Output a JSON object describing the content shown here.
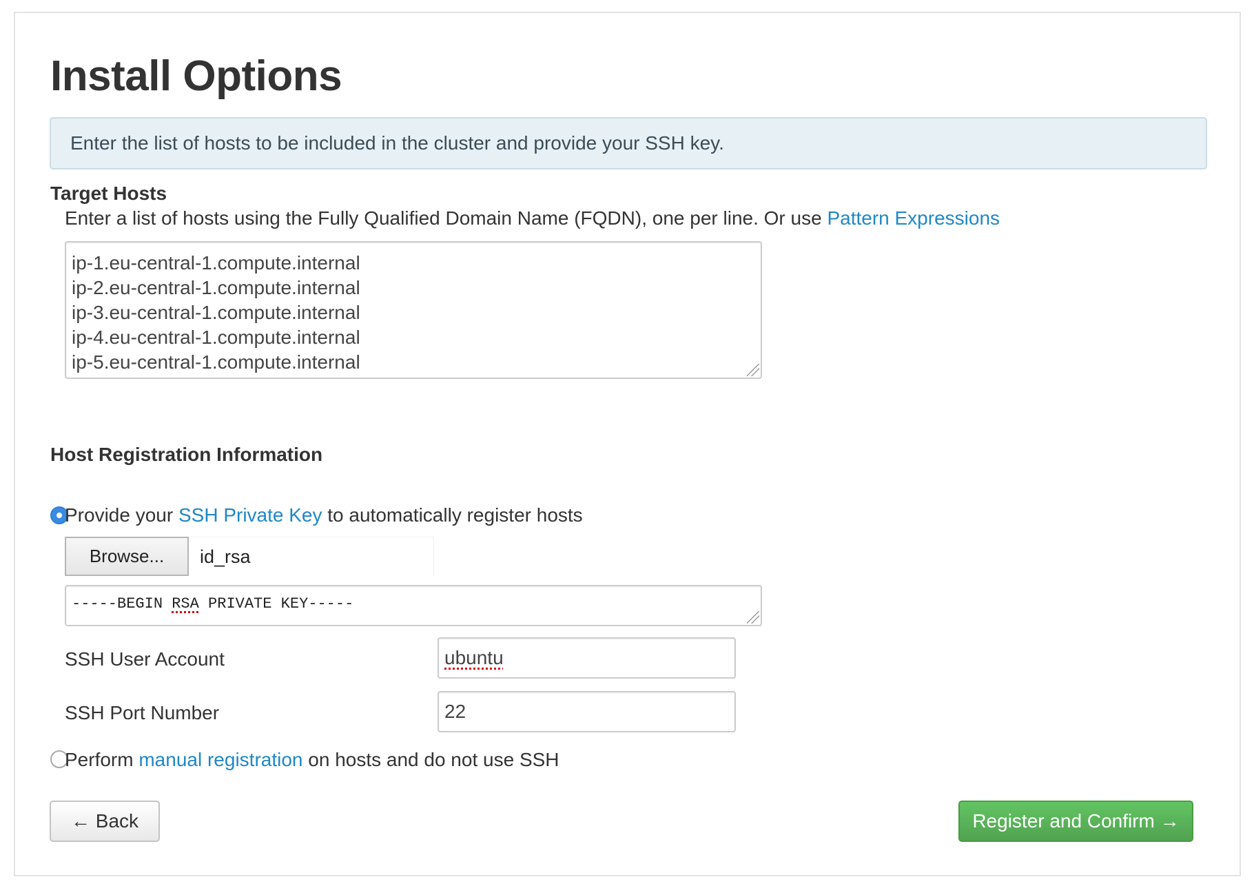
{
  "page": {
    "title": "Install Options",
    "info": "Enter the list of hosts to be included in the cluster and provide your SSH key."
  },
  "target_hosts": {
    "title": "Target Hosts",
    "help_prefix": "Enter a list of hosts using the Fully Qualified Domain Name (FQDN), one per line. Or use ",
    "help_link": "Pattern Expressions",
    "hosts": [
      "ip-1.eu-central-1.compute.internal",
      "ip-2.eu-central-1.compute.internal",
      "ip-3.eu-central-1.compute.internal",
      "ip-4.eu-central-1.compute.internal",
      "ip-5.eu-central-1.compute.internal"
    ]
  },
  "registration": {
    "title": "Host Registration Information",
    "ssh_option": {
      "prefix": "Provide your ",
      "link": "SSH Private Key",
      "suffix": " to automatically register hosts",
      "selected": true
    },
    "browse_label": "Browse...",
    "file_name": "id_rsa",
    "key_text": {
      "before": "-----BEGIN ",
      "flagged": "RSA",
      "after": " PRIVATE KEY-----"
    },
    "ssh_user_label": "SSH User Account",
    "ssh_user_value": "ubuntu",
    "ssh_port_label": "SSH Port Number",
    "ssh_port_value": "22",
    "manual_option": {
      "prefix": "Perform ",
      "link": "manual registration",
      "suffix": " on hosts and do not use SSH",
      "selected": false
    }
  },
  "actions": {
    "back_label": "← Back",
    "next_label": "Register and Confirm →"
  },
  "colors": {
    "link": "#1f87c6",
    "primary_green": "#5cb85c",
    "radio_selected": "#3b8be3",
    "alert_bg": "#e6f0f5"
  }
}
